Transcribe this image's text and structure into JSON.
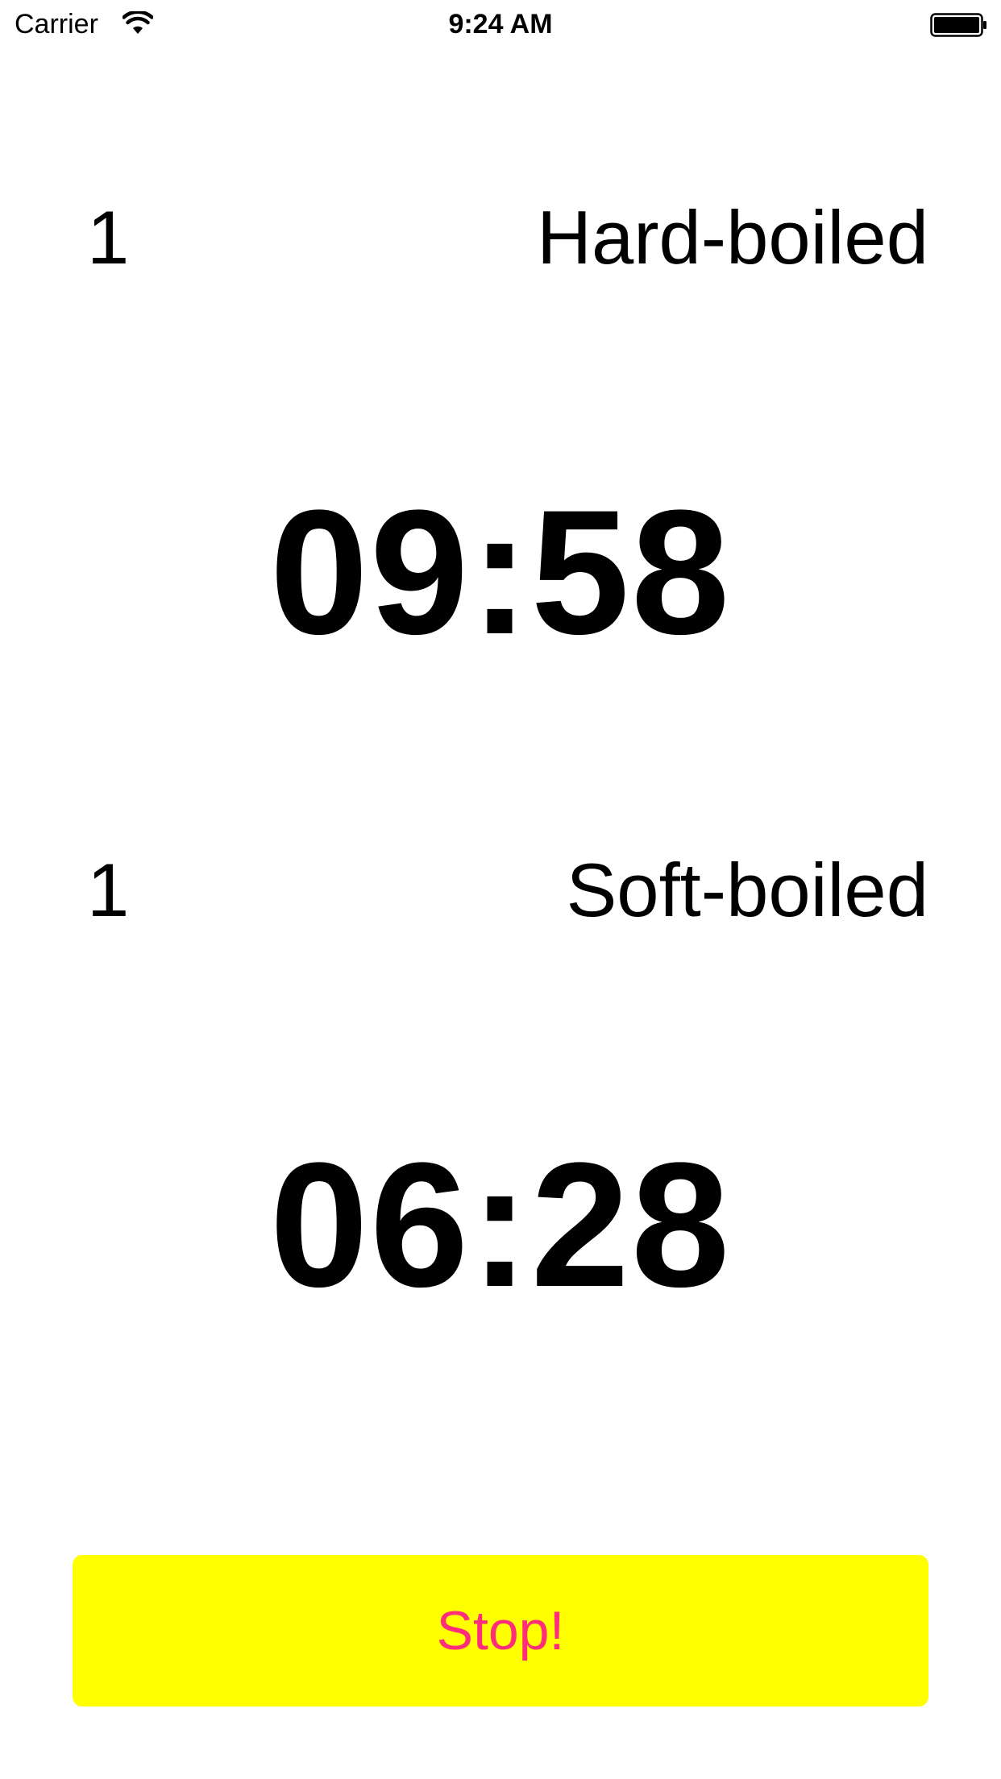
{
  "status_bar": {
    "carrier": "Carrier",
    "time": "9:24 AM",
    "wifi_icon": "wifi-icon",
    "battery_icon": "battery-icon"
  },
  "timers": [
    {
      "count": "1",
      "type": "Hard-boiled",
      "remaining": "09:58"
    },
    {
      "count": "1",
      "type": "Soft-boiled",
      "remaining": "06:28"
    }
  ],
  "stop_button": {
    "label": "Stop!",
    "background": "#ffff00",
    "text_color": "#ff2d7a"
  }
}
